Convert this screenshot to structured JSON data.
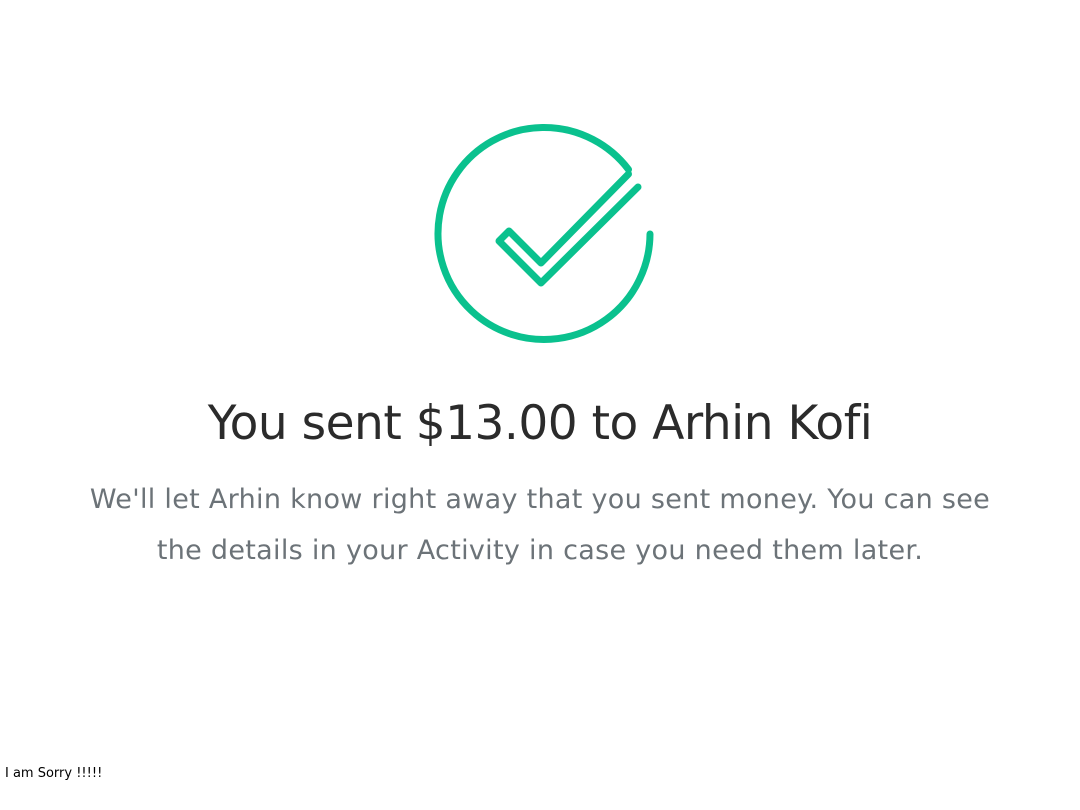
{
  "confirmation": {
    "icon": "check-circle-icon",
    "accent_color": "#0ac18e",
    "title": "You sent $13.00 to Arhin Kofi",
    "message": "We'll let Arhin know right away that you sent money. You can see the details in your Activity in case you need them later."
  },
  "footer": {
    "note": "I am Sorry !!!!!"
  }
}
